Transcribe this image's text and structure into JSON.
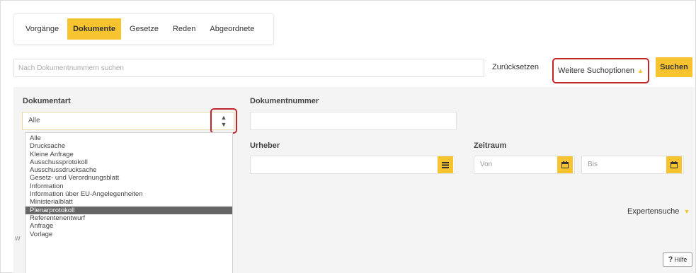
{
  "tabs": [
    {
      "label": "Vorgänge",
      "active": false
    },
    {
      "label": "Dokumente",
      "active": true
    },
    {
      "label": "Gesetze",
      "active": false
    },
    {
      "label": "Reden",
      "active": false
    },
    {
      "label": "Abgeordnete",
      "active": false
    }
  ],
  "search": {
    "placeholder": "Nach Dokumentnummern suchen",
    "value": "",
    "reset_label": "Zurücksetzen",
    "more_options_label": "Weitere Suchoptionen",
    "submit_label": "Suchen"
  },
  "filters": {
    "doc_type": {
      "label": "Dokumentart",
      "selected": "Alle",
      "options": [
        "Alle",
        "Drucksache",
        "Kleine Anfrage",
        "Ausschussprotokoll",
        "Ausschussdrucksache",
        "Gesetz- und Verordnungsblatt",
        "Information",
        "Information über EU-Angelegenheiten",
        "Ministerialblatt",
        "Plenarprotokoll",
        "Referentenentwurf",
        "Anfrage",
        "Vorlage"
      ],
      "highlighted_option": "Plenarprotokoll"
    },
    "doc_number": {
      "label": "Dokumentnummer",
      "value": ""
    },
    "author": {
      "label": "Urheber",
      "value": ""
    },
    "period": {
      "label": "Zeitraum",
      "from_placeholder": "Von",
      "to_placeholder": "Bis"
    }
  },
  "expert_search_label": "Expertensuche",
  "hidden_fragment": "W",
  "help": {
    "icon": "?",
    "label": "Hilfe"
  },
  "colors": {
    "accent": "#f7c32e",
    "highlight_box": "#c0272d",
    "panel_bg": "#f4f4f4",
    "option_highlight": "#666666"
  },
  "icons": {
    "calendar": "calendar-icon",
    "list": "list-icon",
    "chevron_up": "chevron-up-icon",
    "chevron_down": "chevron-down-icon",
    "select_arrows": "select-arrows-icon"
  }
}
